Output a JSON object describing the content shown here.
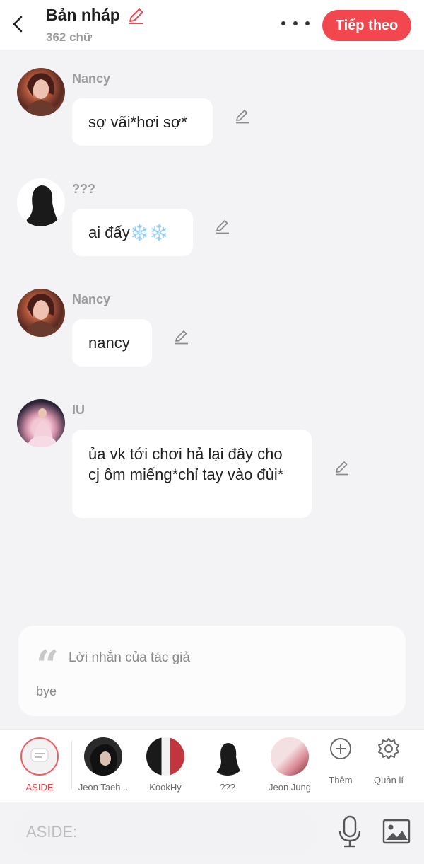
{
  "header": {
    "title": "Bản nháp",
    "word_count": "362 chữ",
    "next_label": "Tiếp theo",
    "accent": "#f2474f"
  },
  "messages": [
    {
      "name": "Nancy",
      "text": "sợ vãi*hơi sợ*"
    },
    {
      "name": "???",
      "text": "ai đấy❄️❄️"
    },
    {
      "name": "Nancy",
      "text": "nancy"
    },
    {
      "name": "IU",
      "text": "ủa vk tới chơi hả lại đây cho cj ôm miếng*chỉ tay vào đùi*"
    }
  ],
  "author_note": {
    "label": "Lời nhắn của tác giả",
    "text": "bye"
  },
  "characters": [
    {
      "label": "ASIDE"
    },
    {
      "label": "Jeon Taeh..."
    },
    {
      "label": "KookHy"
    },
    {
      "label": "???"
    },
    {
      "label": "Jeon Jung"
    }
  ],
  "tools": {
    "add_label": "Thêm",
    "manage_label": "Quản lí"
  },
  "input": {
    "placeholder": "ASIDE:"
  }
}
